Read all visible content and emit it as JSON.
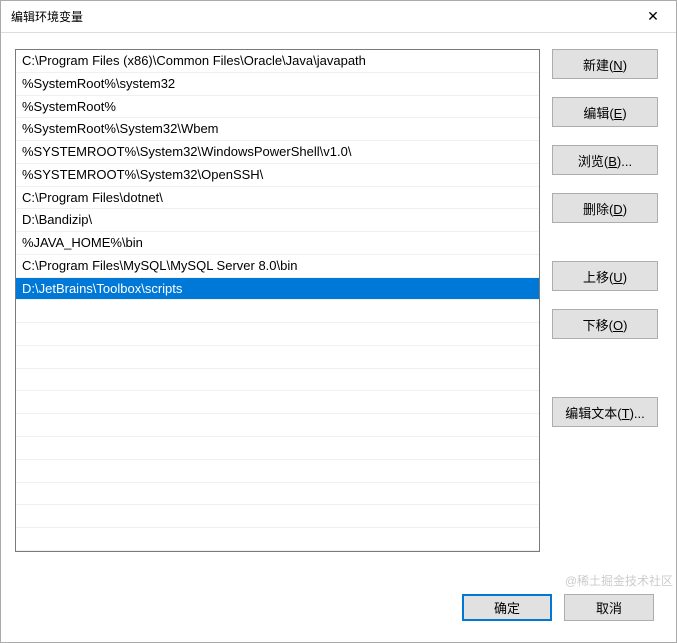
{
  "window": {
    "title": "编辑环境变量",
    "close_label": "✕"
  },
  "list": {
    "items": [
      "C:\\Program Files (x86)\\Common Files\\Oracle\\Java\\javapath",
      "%SystemRoot%\\system32",
      "%SystemRoot%",
      "%SystemRoot%\\System32\\Wbem",
      "%SYSTEMROOT%\\System32\\WindowsPowerShell\\v1.0\\",
      "%SYSTEMROOT%\\System32\\OpenSSH\\",
      "C:\\Program Files\\dotnet\\",
      "D:\\Bandizip\\",
      "%JAVA_HOME%\\bin",
      "C:\\Program Files\\MySQL\\MySQL Server 8.0\\bin",
      "D:\\JetBrains\\Toolbox\\scripts"
    ],
    "selected_index": 10
  },
  "buttons": {
    "new": "新建(N)",
    "edit": "编辑(E)",
    "browse": "浏览(B)...",
    "delete": "删除(D)",
    "move_up": "上移(U)",
    "move_down": "下移(O)",
    "edit_text": "编辑文本(T)...",
    "ok": "确定",
    "cancel": "取消"
  },
  "watermark": "@稀土掘金技术社区"
}
